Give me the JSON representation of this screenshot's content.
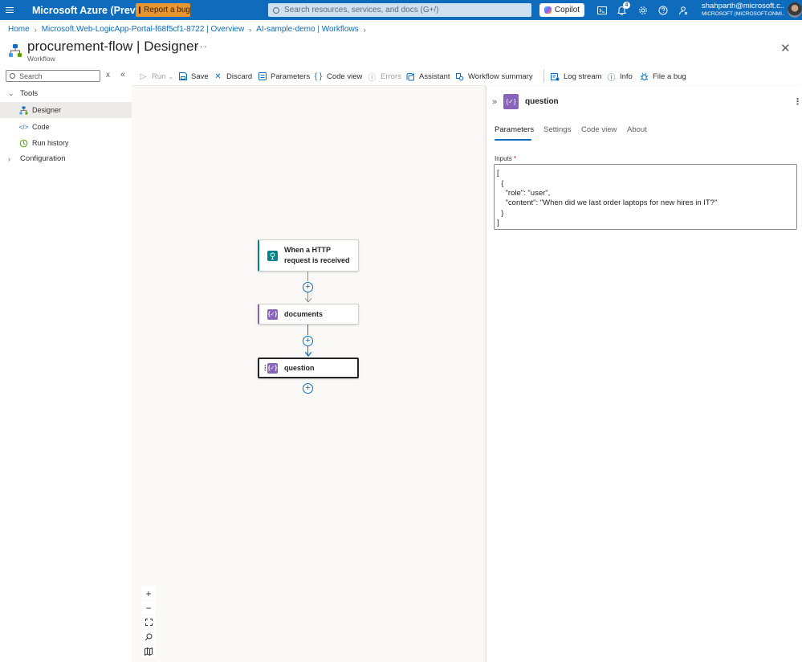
{
  "topbar": {
    "brand": "Microsoft Azure (Preview)",
    "report_bug": "Report a bug",
    "search_placeholder": "Search resources, services, and docs (G+/)",
    "copilot": "Copilot",
    "notifications_count": "4",
    "user_email": "shahparth@microsoft.c...",
    "user_tenant": "MICROSOFT (MICROSOFT.ONMI..."
  },
  "breadcrumb": [
    "Home",
    "Microsoft.Web-LogicApp-Portal-f68f5cf1-8722 | Overview",
    "AI-sample-demo | Workflows"
  ],
  "header": {
    "title": "procurement-flow",
    "title_sep": " | ",
    "title_section": "Designer",
    "subtitle": "Workflow"
  },
  "nav": {
    "search_placeholder": "Search",
    "groups": [
      {
        "label": "Tools",
        "expanded": true,
        "items": [
          {
            "label": "Designer",
            "active": true
          },
          {
            "label": "Code"
          },
          {
            "label": "Run history"
          }
        ]
      },
      {
        "label": "Configuration",
        "expanded": false
      }
    ]
  },
  "commands": {
    "run": "Run",
    "save": "Save",
    "discard": "Discard",
    "parameters": "Parameters",
    "code_view": "Code view",
    "errors": "Errors",
    "assistant": "Assistant",
    "workflow_summary": "Workflow summary",
    "log_stream": "Log stream",
    "info": "Info",
    "file_bug": "File a bug"
  },
  "canvas": {
    "nodes": [
      {
        "label": "When a HTTP request is received",
        "type": "trigger",
        "color": "#038387"
      },
      {
        "label": "documents",
        "type": "compose",
        "color": "#8764b8"
      },
      {
        "label": "question",
        "type": "compose",
        "color": "#8764b8",
        "selected": true
      }
    ]
  },
  "panel": {
    "title": "question",
    "tabs": [
      "Parameters",
      "Settings",
      "Code view",
      "About"
    ],
    "active_tab": "Parameters",
    "inputs_label": "Inputs",
    "inputs_lines": [
      "[",
      "  {",
      "    \"role\": \"user\",",
      "    \"content\": \"When did we last order laptops for new hires in IT?\"",
      "  }",
      "]"
    ]
  },
  "colors": {
    "accent": "#0f6cbd",
    "bug_button": "#e8962f",
    "trigger": "#038387",
    "compose": "#8764b8"
  }
}
